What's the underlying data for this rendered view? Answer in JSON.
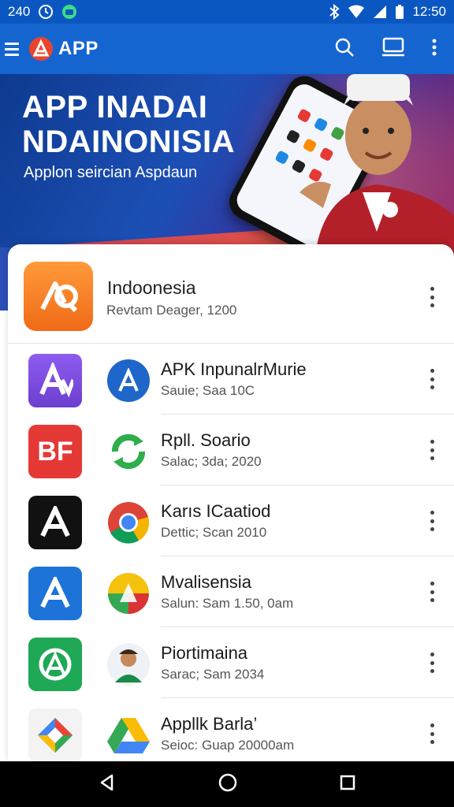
{
  "status_bar": {
    "notification_count": "240",
    "time": "12:50",
    "icons": [
      "clock-icon",
      "android-icon",
      "bluetooth-icon",
      "wifi-icon",
      "signal-icon",
      "battery-icon"
    ]
  },
  "app_bar": {
    "title": "APP",
    "icons": [
      "menu-icon",
      "app-logo-icon",
      "search-icon",
      "cast-icon",
      "more-icon"
    ]
  },
  "hero": {
    "title_line1": "APP INADAI",
    "title_line2": "NDAINONISIA",
    "subtitle": "Applon seircian Aspdaun"
  },
  "featured": {
    "name": "Indoonesia",
    "meta": "Revtam Deager, 1200",
    "icon_color": "#f57c1f"
  },
  "apps": [
    {
      "title": "APK InpunalrMurie",
      "sub": "Sauie; Saa 10C",
      "icon1": "a-purple-icon",
      "icon2": "a-blue-circle-icon"
    },
    {
      "title": "Rpll. Soario",
      "sub": "Salac; 3da; 2020",
      "icon1": "bf-red-icon",
      "icon2": "green-refresh-icon"
    },
    {
      "title": "Karıs ICaatiod",
      "sub": "Dettic; Scan 2010",
      "icon1": "a-black-icon",
      "icon2": "chrome-icon"
    },
    {
      "title": "Mvalisensia",
      "sub": "Salun: Sam 1.50, 0am",
      "icon1": "a-blue-icon",
      "icon2": "drive-like-icon"
    },
    {
      "title": "Piortimaina",
      "sub": "Sarac; Sam 2034",
      "icon1": "a-green-icon",
      "icon2": "avatar-icon"
    },
    {
      "title": "Appllk Barla’",
      "sub": "Seioc: Guap 20000am",
      "icon1": "gem-multicolor-icon",
      "icon2": "google-drive-icon"
    }
  ],
  "colors": {
    "status_bar": "#0b57c2",
    "app_bar": "#1565d0",
    "accent_orange": "#f57c1f"
  },
  "nav_bar": {
    "icons": [
      "back-icon",
      "home-icon",
      "recents-icon"
    ]
  }
}
